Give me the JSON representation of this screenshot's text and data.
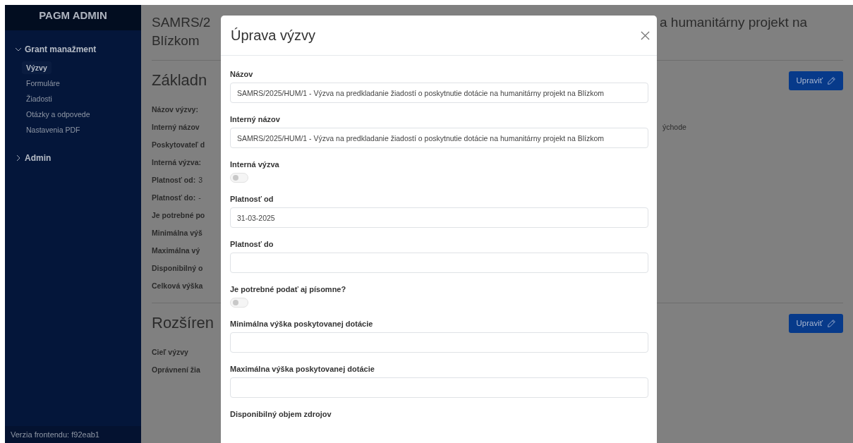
{
  "sidebar": {
    "title": "PAGM ADMIN",
    "groups": [
      {
        "label": "Grant manažment",
        "expanded": true,
        "children": [
          {
            "label": "Výzvy",
            "selected": true
          },
          {
            "label": "Formuláre",
            "selected": false
          },
          {
            "label": "Žiadosti",
            "selected": false
          },
          {
            "label": "Otázky a odpovede",
            "selected": false
          },
          {
            "label": "Nastavenia PDF",
            "selected": false
          }
        ]
      },
      {
        "label": "Admin",
        "expanded": false
      }
    ],
    "footer": "Verzia frontendu: f92eab1"
  },
  "page": {
    "title_lines": [
      {
        "left": "SAMRS/2",
        "right": "a humanitárny projekt na"
      },
      {
        "left": "Blízkom"
      }
    ],
    "sections": [
      {
        "heading": "Základn",
        "button": "Upraviť",
        "rows": [
          {
            "label": "Názov výzvy:"
          },
          {
            "label": "Interný názov",
            "right": "ýchode"
          },
          {
            "label": "Poskytovateľ d"
          },
          {
            "label": "Interná výzva:"
          },
          {
            "label": "Platnosť od:",
            "value": "3"
          },
          {
            "label": "Platnosť do:",
            "value": "-"
          },
          {
            "label": "Je potrebné po"
          },
          {
            "label": "Minimálna výš"
          },
          {
            "label": "Maximálna vý"
          },
          {
            "label": "Disponibilný o"
          },
          {
            "label": "Celková výška"
          }
        ]
      },
      {
        "heading": "Rozšíren",
        "button": "Upraviť",
        "rows": [
          {
            "label": "Cieľ výzvy"
          },
          {
            "label": "Oprávnení žia"
          }
        ]
      }
    ]
  },
  "modal": {
    "title": "Úprava výzvy",
    "fields": [
      {
        "kind": "text",
        "label": "Názov",
        "value": "SAMRS/2025/HUM/1 - Výzva na predkladanie žiadostí o poskytnutie dotácie na humanitárny projekt na Blízkom"
      },
      {
        "kind": "text",
        "label": "Interný názov",
        "value": "SAMRS/2025/HUM/1 - Výzva na predkladanie žiadostí o poskytnutie dotácie na humanitárny projekt na Blízkom"
      },
      {
        "kind": "toggle",
        "label": "Interná výzva",
        "on": false
      },
      {
        "kind": "text",
        "label": "Platnosť od",
        "value": "31-03-2025"
      },
      {
        "kind": "text",
        "label": "Platnosť do"
      },
      {
        "kind": "toggle",
        "label": "Je potrebné podať aj písomne?",
        "on": false
      },
      {
        "kind": "text",
        "label": "Minimálna výška poskytovanej dotácie"
      },
      {
        "kind": "text",
        "label": "Maximálna výška poskytovanej dotácie"
      },
      {
        "kind": "heading",
        "label": "Disponibilný objem zdrojov"
      }
    ]
  }
}
